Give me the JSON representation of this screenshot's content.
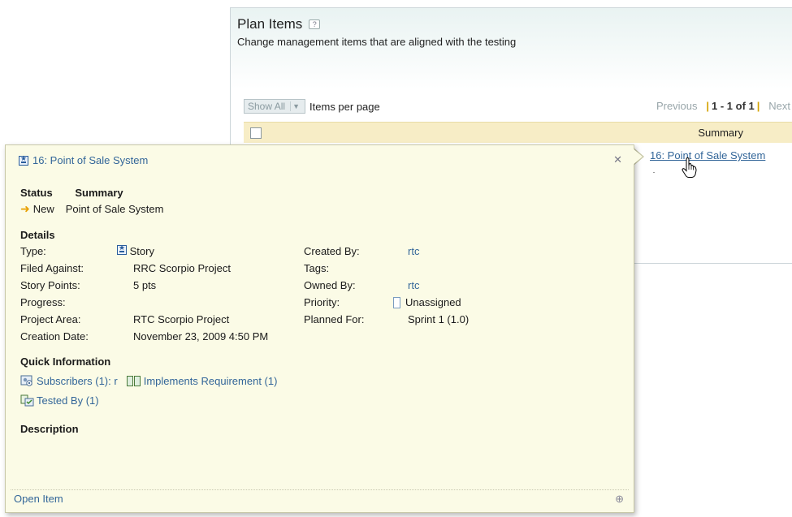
{
  "panel": {
    "title": "Plan Items",
    "help_icon": "?",
    "description": "Change management items that are aligned with the testing",
    "show_all": "Show All",
    "items_per_page": "Items per page",
    "pager": {
      "previous": "Previous",
      "current": "1 - 1 of 1",
      "next": "Next"
    },
    "columns": {
      "summary": "Summary"
    },
    "row_link": "16: Point of Sale System"
  },
  "popup": {
    "title": "16: Point of Sale System",
    "status_header": "Status",
    "summary_header": "Summary",
    "status_value": "New",
    "summary_value": "Point of Sale System",
    "details_heading": "Details",
    "details": {
      "type_label": "Type:",
      "type_value": "Story",
      "filed_against_label": "Filed Against:",
      "filed_against_value": "RRC Scorpio Project",
      "story_points_label": "Story Points:",
      "story_points_value": "5 pts",
      "progress_label": "Progress:",
      "progress_value": "",
      "project_area_label": "Project Area:",
      "project_area_value": "RTC Scorpio Project",
      "creation_date_label": "Creation Date:",
      "creation_date_value": "November 23, 2009 4:50 PM",
      "created_by_label": "Created By:",
      "created_by_value": "rtc",
      "tags_label": "Tags:",
      "tags_value": "",
      "owned_by_label": "Owned By:",
      "owned_by_value": "rtc",
      "priority_label": "Priority:",
      "priority_value": "Unassigned",
      "planned_for_label": "Planned For:",
      "planned_for_value": "Sprint 1 (1.0)"
    },
    "quick_info_heading": "Quick Information",
    "subscribers": "Subscribers (1): r",
    "implements_requirement": "Implements Requirement (1)",
    "tested_by": "Tested By (1)",
    "description_heading": "Description",
    "open_item": "Open Item",
    "close_glyph": "✕",
    "expand_glyph": "⊕"
  },
  "icons": [
    "help-icon",
    "story-icon",
    "close-icon",
    "status-arrow-icon",
    "priority-icon",
    "subscribers-icon",
    "requirement-icon",
    "tested-by-icon",
    "expand-icon",
    "hand-cursor-icon"
  ],
  "colors": {
    "link": "#336699",
    "popup_bg": "#fbfbe6",
    "header_bg": "#f7edc6",
    "status_arrow": "#e8a000"
  }
}
